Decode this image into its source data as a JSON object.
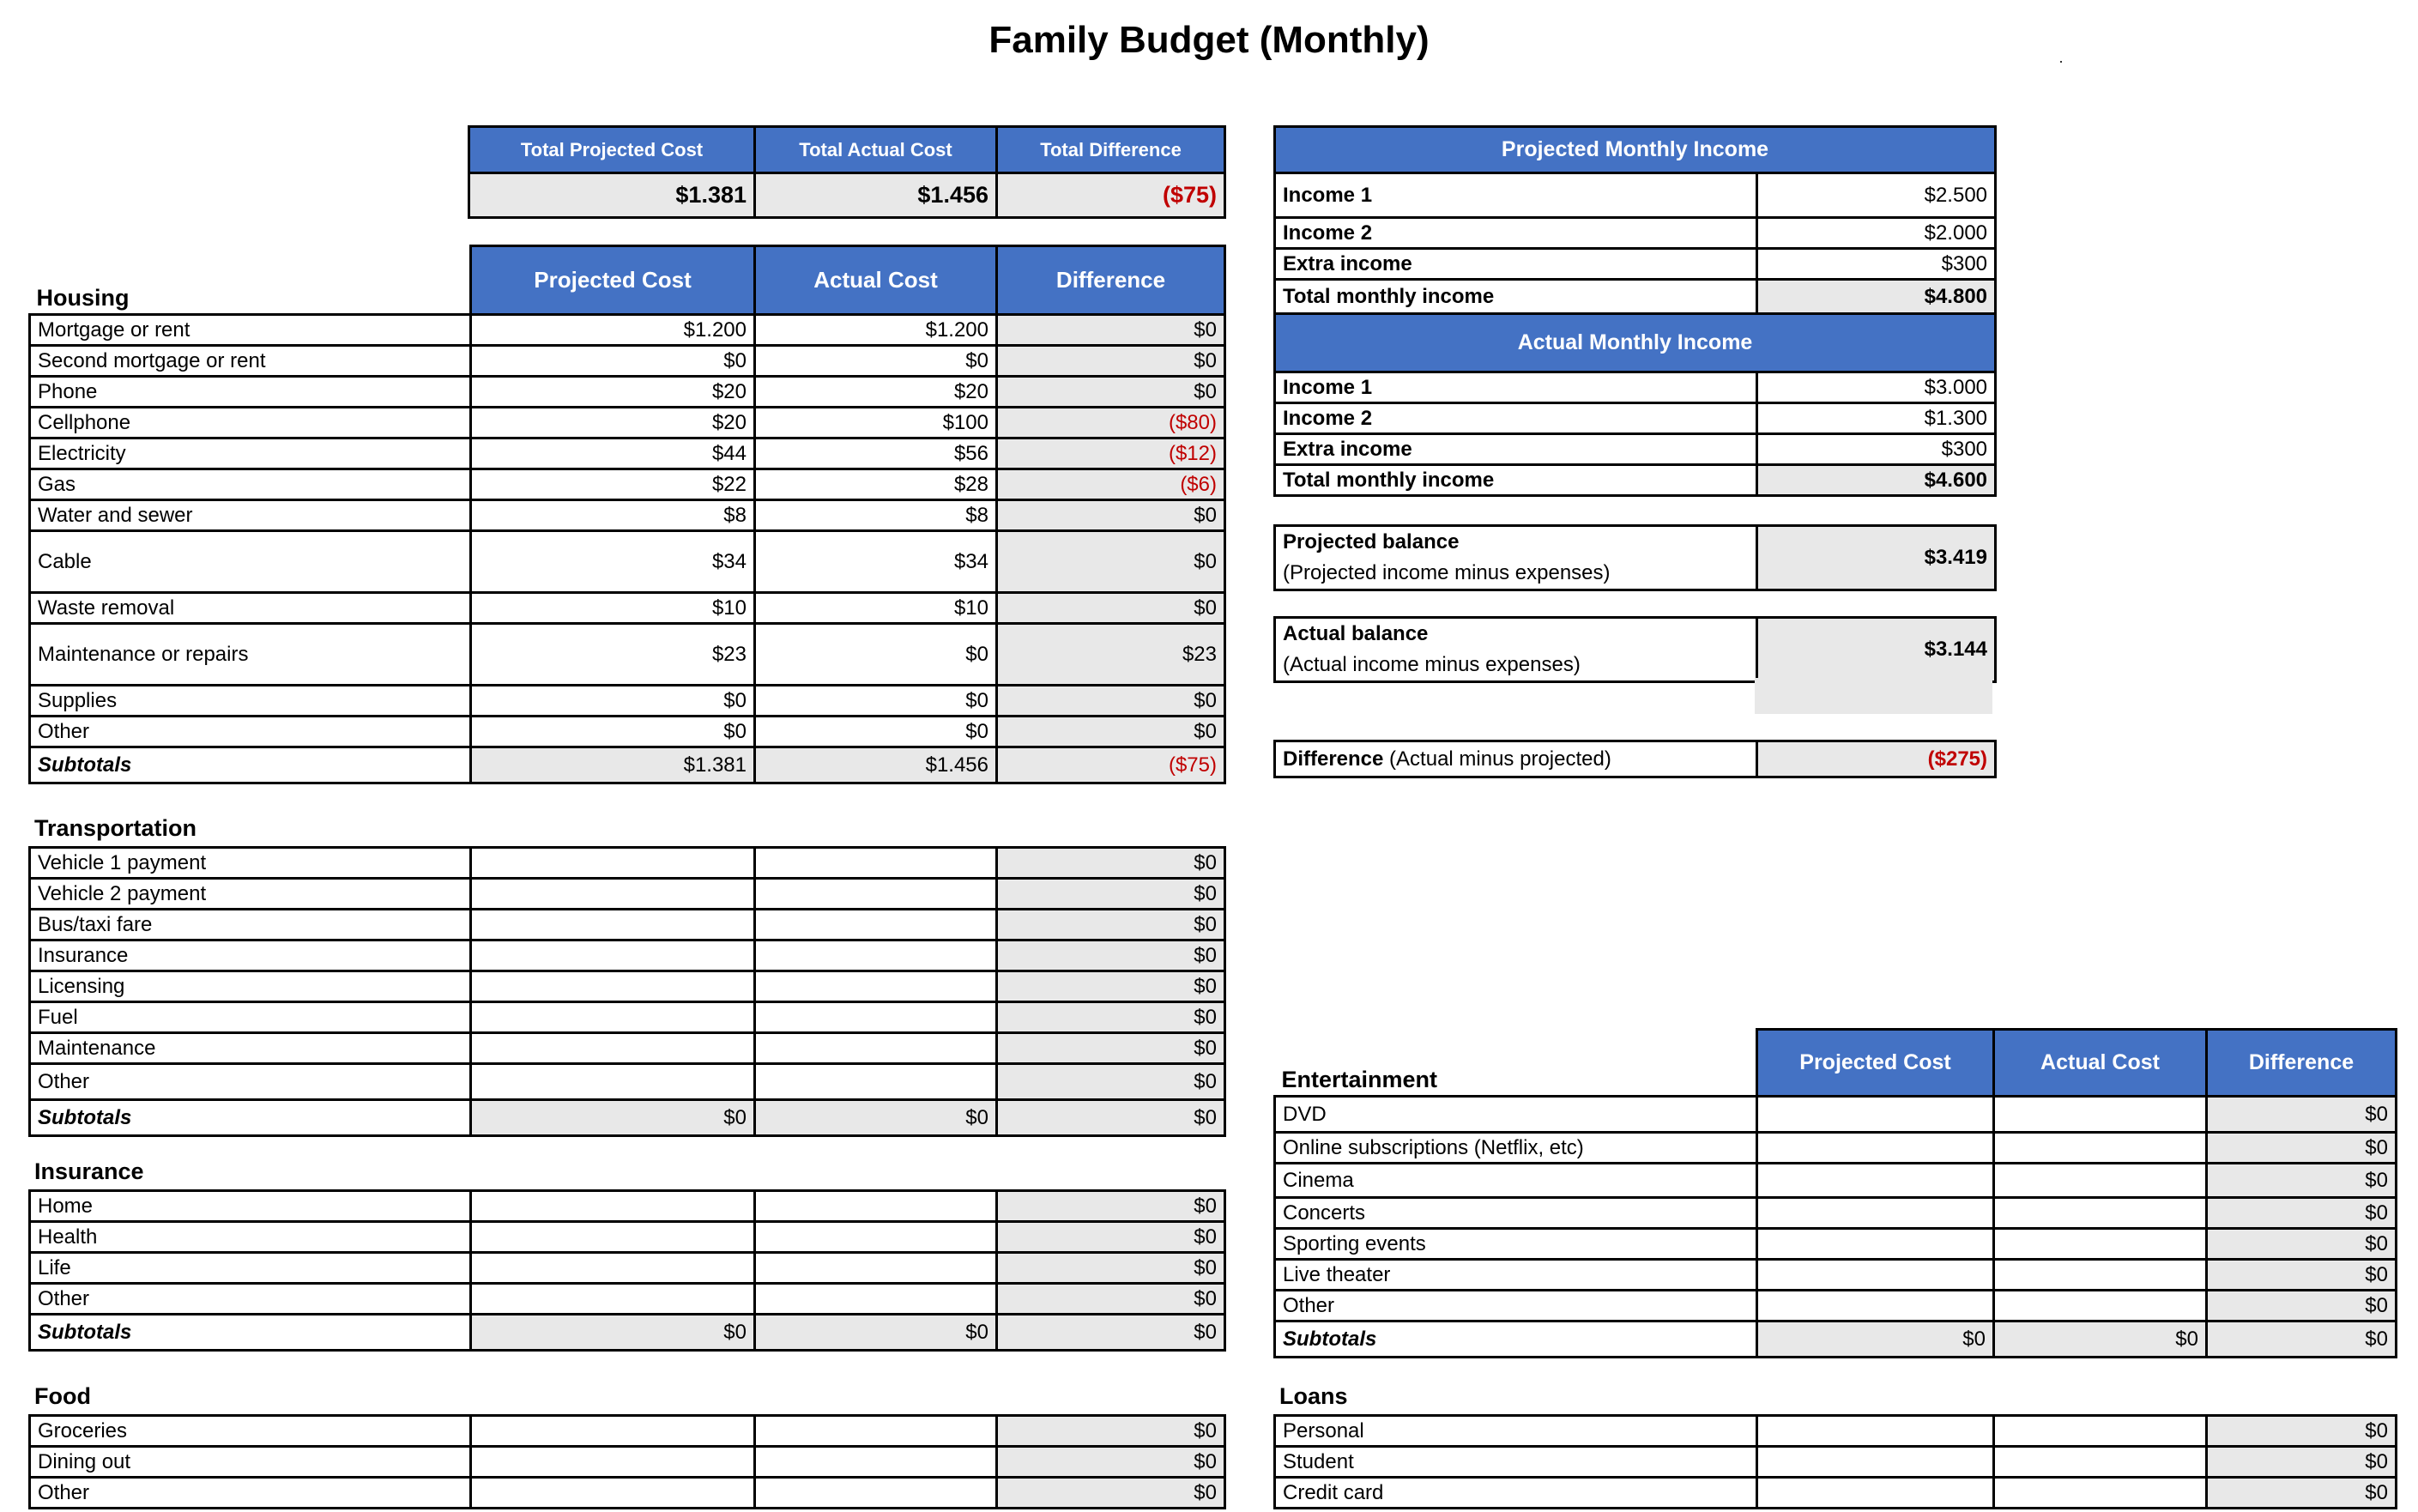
{
  "title": "Family Budget (Monthly)",
  "summary": {
    "headers": [
      "Total Projected Cost",
      "Total Actual Cost",
      "Total Difference"
    ],
    "values": [
      "$1.381",
      "$1.456",
      "($75)"
    ]
  },
  "columns": [
    "Projected Cost",
    "Actual Cost",
    "Difference"
  ],
  "colors": {
    "header_blue": "#4472C4",
    "calc_gray": "#E8E8E8",
    "negative_red": "#C00000"
  },
  "housing": {
    "label": "Housing",
    "rows": [
      {
        "name": "Mortgage or rent",
        "projected": "$1.200",
        "actual": "$1.200",
        "difference": "$0"
      },
      {
        "name": "Second mortgage or rent",
        "projected": "$0",
        "actual": "$0",
        "difference": "$0"
      },
      {
        "name": "Phone",
        "projected": "$20",
        "actual": "$20",
        "difference": "$0"
      },
      {
        "name": "Cellphone",
        "projected": "$20",
        "actual": "$100",
        "difference": "($80)"
      },
      {
        "name": "Electricity",
        "projected": "$44",
        "actual": "$56",
        "difference": "($12)"
      },
      {
        "name": "Gas",
        "projected": "$22",
        "actual": "$28",
        "difference": "($6)"
      },
      {
        "name": "Water and sewer",
        "projected": "$8",
        "actual": "$8",
        "difference": "$0"
      },
      {
        "name": "Cable",
        "projected": "$34",
        "actual": "$34",
        "difference": "$0"
      },
      {
        "name": "Waste removal",
        "projected": "$10",
        "actual": "$10",
        "difference": "$0"
      },
      {
        "name": "Maintenance or repairs",
        "projected": "$23",
        "actual": "$0",
        "difference": "$23"
      },
      {
        "name": "Supplies",
        "projected": "$0",
        "actual": "$0",
        "difference": "$0"
      },
      {
        "name": "Other",
        "projected": "$0",
        "actual": "$0",
        "difference": "$0"
      }
    ],
    "subtotal": {
      "name": "Subtotals",
      "projected": "$1.381",
      "actual": "$1.456",
      "difference": "($75)"
    }
  },
  "transportation": {
    "label": "Transportation",
    "rows": [
      {
        "name": "Vehicle 1 payment",
        "projected": "",
        "actual": "",
        "difference": "$0"
      },
      {
        "name": "Vehicle 2 payment",
        "projected": "",
        "actual": "",
        "difference": "$0"
      },
      {
        "name": "Bus/taxi fare",
        "projected": "",
        "actual": "",
        "difference": "$0"
      },
      {
        "name": "Insurance",
        "projected": "",
        "actual": "",
        "difference": "$0"
      },
      {
        "name": "Licensing",
        "projected": "",
        "actual": "",
        "difference": "$0"
      },
      {
        "name": "Fuel",
        "projected": "",
        "actual": "",
        "difference": "$0"
      },
      {
        "name": "Maintenance",
        "projected": "",
        "actual": "",
        "difference": "$0"
      },
      {
        "name": "Other",
        "projected": "",
        "actual": "",
        "difference": "$0"
      }
    ],
    "subtotal": {
      "name": "Subtotals",
      "projected": "$0",
      "actual": "$0",
      "difference": "$0"
    }
  },
  "insurance": {
    "label": "Insurance",
    "rows": [
      {
        "name": "Home",
        "projected": "",
        "actual": "",
        "difference": "$0"
      },
      {
        "name": "Health",
        "projected": "",
        "actual": "",
        "difference": "$0"
      },
      {
        "name": "Life",
        "projected": "",
        "actual": "",
        "difference": "$0"
      },
      {
        "name": "Other",
        "projected": "",
        "actual": "",
        "difference": "$0"
      }
    ],
    "subtotal": {
      "name": "Subtotals",
      "projected": "$0",
      "actual": "$0",
      "difference": "$0"
    }
  },
  "food": {
    "label": "Food",
    "rows": [
      {
        "name": "Groceries",
        "projected": "",
        "actual": "",
        "difference": "$0"
      },
      {
        "name": "Dining out",
        "projected": "",
        "actual": "",
        "difference": "$0"
      },
      {
        "name": "Other",
        "projected": "",
        "actual": "",
        "difference": "$0"
      }
    ]
  },
  "projected_income": {
    "header": "Projected Monthly Income",
    "rows": [
      {
        "name": "Income 1",
        "value": "$2.500"
      },
      {
        "name": "Income 2",
        "value": "$2.000"
      },
      {
        "name": "Extra income",
        "value": "$300"
      }
    ],
    "total": {
      "name": "Total monthly income",
      "value": "$4.800"
    }
  },
  "actual_income": {
    "header": "Actual Monthly Income",
    "rows": [
      {
        "name": "Income 1",
        "value": "$3.000"
      },
      {
        "name": "Income 2",
        "value": "$1.300"
      },
      {
        "name": "Extra income",
        "value": "$300"
      }
    ],
    "total": {
      "name": "Total monthly income",
      "value": "$4.600"
    }
  },
  "balances": {
    "projected": {
      "label": "Projected balance",
      "note": "(Projected income minus expenses)",
      "value": "$3.419"
    },
    "actual": {
      "label": "Actual balance",
      "note": "(Actual income minus expenses)",
      "value": "$3.144"
    },
    "difference": {
      "label": "Difference",
      "note": "(Actual minus projected)",
      "value": "($275)"
    }
  },
  "entertainment": {
    "label": "Entertainment",
    "rows": [
      {
        "name": "DVD",
        "projected": "",
        "actual": "",
        "difference": "$0"
      },
      {
        "name": "Online subscriptions (Netflix, etc)",
        "projected": "",
        "actual": "",
        "difference": "$0"
      },
      {
        "name": "Cinema",
        "projected": "",
        "actual": "",
        "difference": "$0"
      },
      {
        "name": "Concerts",
        "projected": "",
        "actual": "",
        "difference": "$0"
      },
      {
        "name": "Sporting events",
        "projected": "",
        "actual": "",
        "difference": "$0"
      },
      {
        "name": "Live theater",
        "projected": "",
        "actual": "",
        "difference": "$0"
      },
      {
        "name": "Other",
        "projected": "",
        "actual": "",
        "difference": "$0"
      }
    ],
    "subtotal": {
      "name": "Subtotals",
      "projected": "$0",
      "actual": "$0",
      "difference": "$0"
    }
  },
  "loans": {
    "label": "Loans",
    "rows": [
      {
        "name": "Personal",
        "projected": "",
        "actual": "",
        "difference": "$0"
      },
      {
        "name": "Student",
        "projected": "",
        "actual": "",
        "difference": "$0"
      },
      {
        "name": "Credit card",
        "projected": "",
        "actual": "",
        "difference": "$0"
      }
    ]
  }
}
